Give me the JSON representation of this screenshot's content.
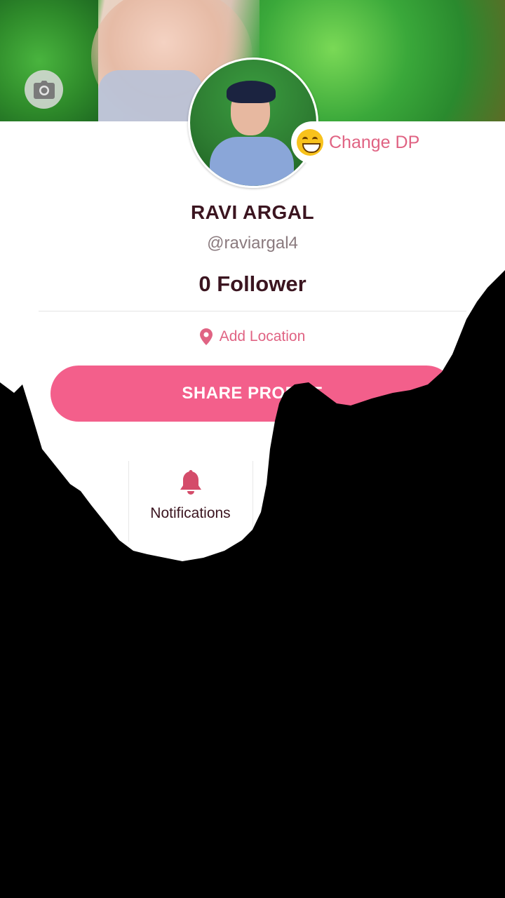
{
  "profile": {
    "name": "RAVI ARGAL",
    "handle": "@raviargal4",
    "followers": "0 Follower",
    "change_dp_label": "Change DP",
    "location_label": "Add Location",
    "share_label": "SHARE PROFILE"
  },
  "tiles": [
    {
      "label": "Notifications",
      "icon": "bell-icon"
    }
  ],
  "colors": {
    "accent": "#f35f8b",
    "accent_text": "#e06383",
    "name_text": "#3b1520",
    "overlay": "#000000"
  },
  "icons": {
    "camera": "camera-icon",
    "emoji": "grinning-face-icon",
    "location": "map-pin-icon",
    "bell": "bell-icon"
  }
}
